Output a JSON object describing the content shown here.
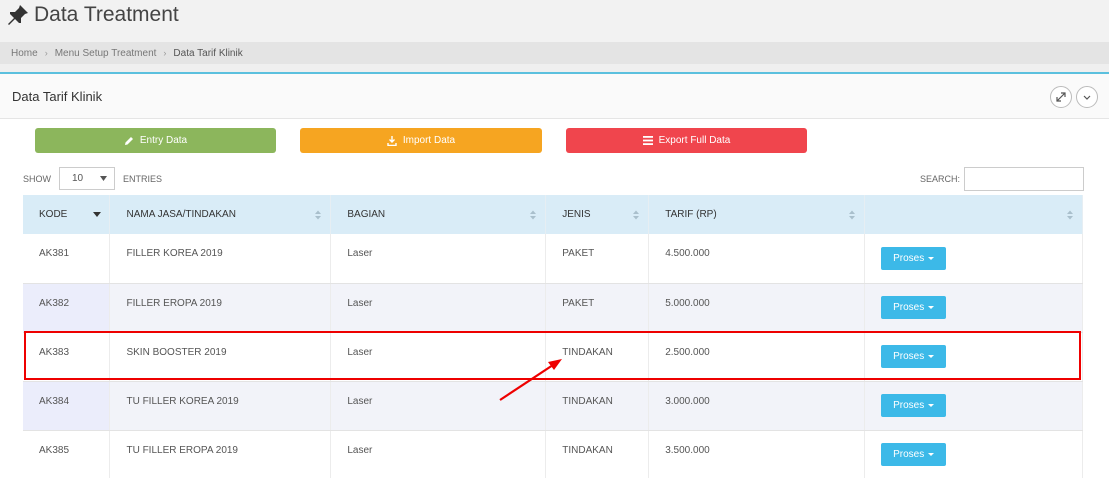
{
  "header": {
    "title": "Data Treatment",
    "pin_icon": "pushpin-icon"
  },
  "breadcrumb": {
    "items": [
      "Home",
      "Menu Setup Treatment",
      "Data Tarif Klinik"
    ]
  },
  "panel": {
    "title": "Data Tarif Klinik"
  },
  "toolbar": {
    "entry_label": "Entry Data",
    "import_label": "Import Data",
    "export_label": "Export Full Data"
  },
  "colors": {
    "entry": "#8cb65c",
    "import": "#f6a521",
    "export": "#f0454d",
    "proses": "#3cb9e8",
    "header_row": "#d9ecf7",
    "accent": "#5bc0de",
    "highlight": "#e00000"
  },
  "table_controls": {
    "show_label": "SHOW",
    "entries_value": "10",
    "entries_label": "ENTRIES",
    "search_label": "SEARCH:"
  },
  "table": {
    "columns": [
      "KODE",
      "NAMA JASA/TINDAKAN",
      "BAGIAN",
      "JENIS",
      "TARIF (RP)",
      ""
    ],
    "rows": [
      {
        "kode": "AK381",
        "nama": "FILLER KOREA 2019",
        "bagian": "Laser",
        "jenis": "PAKET",
        "tarif": "4.500.000",
        "action": "Proses"
      },
      {
        "kode": "AK382",
        "nama": "FILLER EROPA 2019",
        "bagian": "Laser",
        "jenis": "PAKET",
        "tarif": "5.000.000",
        "action": "Proses"
      },
      {
        "kode": "AK383",
        "nama": "SKIN BOOSTER 2019",
        "bagian": "Laser",
        "jenis": "TINDAKAN",
        "tarif": "2.500.000",
        "action": "Proses"
      },
      {
        "kode": "AK384",
        "nama": "TU FILLER KOREA 2019",
        "bagian": "Laser",
        "jenis": "TINDAKAN",
        "tarif": "3.000.000",
        "action": "Proses"
      },
      {
        "kode": "AK385",
        "nama": "TU FILLER EROPA 2019",
        "bagian": "Laser",
        "jenis": "TINDAKAN",
        "tarif": "3.500.000",
        "action": "Proses"
      }
    ]
  }
}
